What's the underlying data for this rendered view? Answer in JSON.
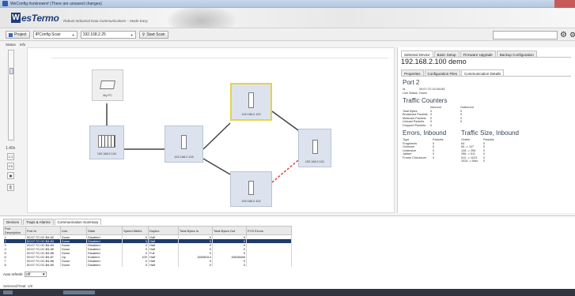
{
  "window": {
    "title": "WeConfig #unknown# (There are unsaved changes)"
  },
  "banner": {
    "logo_text": "WeSTermo",
    "tagline": "Robust Industrial Data Communications – Made Easy"
  },
  "toolbar": {
    "project_label": "Project",
    "scan_select": "IPConfig Scan",
    "ip_select": "192.168.2.25",
    "start_scan_label": "Start Scan"
  },
  "menu": {
    "status": "Status",
    "info": "Info"
  },
  "zoom": {
    "level": "1.40x",
    "buttons": [
      "1:1",
      "Fit",
      "▣",
      "⎘"
    ]
  },
  "topology": {
    "nodes": {
      "my_pc": "My PC",
      "n104": "192.168.2.104",
      "n103": "192.168.2.103",
      "n100": "192.168.2.100",
      "n101": "192.168.2.101",
      "n102": "192.168.2.102"
    },
    "colors": {
      "link": "#444444",
      "broken_link": "#e04040",
      "selected_border": "#e5d34a"
    }
  },
  "right_panel": {
    "tabs": [
      "Selected Device",
      "Basic Setup",
      "Firmware Upgrade",
      "Backup Configuration"
    ],
    "device_title": "192.168.2.100  demo",
    "subtabs": [
      "Properties",
      "Configuration Files",
      "Communication Details"
    ],
    "port_title": "Port  2",
    "port_id_label": "Id",
    "port_id_value": "00:07:7C:0C:B4:83",
    "link_status_label": "Link Status",
    "link_status_value": "Down",
    "traffic_title": "Traffic Counters",
    "traffic_cols": [
      "Inbound",
      "Outbound"
    ],
    "traffic_rows": [
      {
        "label": "Total Bytes",
        "in": "0",
        "out": "0"
      },
      {
        "label": "Broadcast Packets",
        "in": "0",
        "out": "0"
      },
      {
        "label": "Multicast Packets",
        "in": "0",
        "out": "0"
      },
      {
        "label": "Unicast Packets",
        "in": "0",
        "out": "0"
      },
      {
        "label": "Dropped Packets",
        "in": "0",
        "out": ""
      }
    ],
    "errors_title": "Errors, Inbound",
    "errors_cols": [
      "Type",
      "Packets"
    ],
    "errors_rows": [
      {
        "label": "Fragments",
        "v": "0"
      },
      {
        "label": "Oversize",
        "v": "0"
      },
      {
        "label": "Undersize",
        "v": "0"
      },
      {
        "label": "Jabber",
        "v": "0"
      },
      {
        "label": "Frame Checksum",
        "v": "0"
      }
    ],
    "size_title": "Traffic Size, Inbound",
    "size_cols": [
      "Octets",
      "Packets"
    ],
    "size_rows": [
      {
        "label": "64",
        "v": "0"
      },
      {
        "label": "65 -> 127",
        "v": "0"
      },
      {
        "label": "128 -> 255",
        "v": "0"
      },
      {
        "label": "256 -> 511",
        "v": "0"
      },
      {
        "label": "512 -> 1023",
        "v": "0"
      },
      {
        "label": "1024 -> Max",
        "v": "0"
      }
    ]
  },
  "bottom": {
    "tabs": [
      "Devices",
      "Traps & Alarms",
      "Communication Summary"
    ],
    "columns": [
      "Port Description",
      "Port Id",
      "Link",
      "State",
      "Speed Mbit/s",
      "Duplex",
      "Total Bytes In",
      "Total Bytes Out",
      "FCS Errors"
    ],
    "rows": [
      [
        "1",
        "00:07:7C:0C:B4:82",
        "Down",
        "Disabled",
        "0",
        "Half",
        "0",
        "0",
        ""
      ],
      [
        "2",
        "00:07:7C:0C:B4:83",
        "Down",
        "Disabled",
        "0",
        "Half",
        "0",
        "0",
        ""
      ],
      [
        "3",
        "00:07:7C:0C:B4:84",
        "Down",
        "Disabled",
        "0",
        "Half",
        "0",
        "0",
        ""
      ],
      [
        "4",
        "00:07:7C:0C:B4:85",
        "Down",
        "Disabled",
        "0",
        "Half",
        "0",
        "0",
        ""
      ],
      [
        "5",
        "00:07:7C:0C:B4:86",
        "Down",
        "Disabled",
        "0",
        "Full",
        "0",
        "0",
        ""
      ],
      [
        "6",
        "00:07:7C:0C:B4:87",
        "Up",
        "Enabled",
        "100",
        "Half",
        "18698314",
        "18628466",
        ""
      ],
      [
        "7",
        "00:07:7C:0C:B4:88",
        "Down",
        "Disabled",
        "0",
        "Half",
        "0",
        "0",
        ""
      ],
      [
        "8",
        "00:07:7C:0C:B4:89",
        "Down",
        "Disabled",
        "0",
        "Half",
        "0",
        "0",
        ""
      ]
    ],
    "selected_row": 1,
    "auto_refresh_label": "Auto refresh",
    "auto_refresh_value": "Off",
    "status_text": "Selected/Total: 1/8"
  }
}
